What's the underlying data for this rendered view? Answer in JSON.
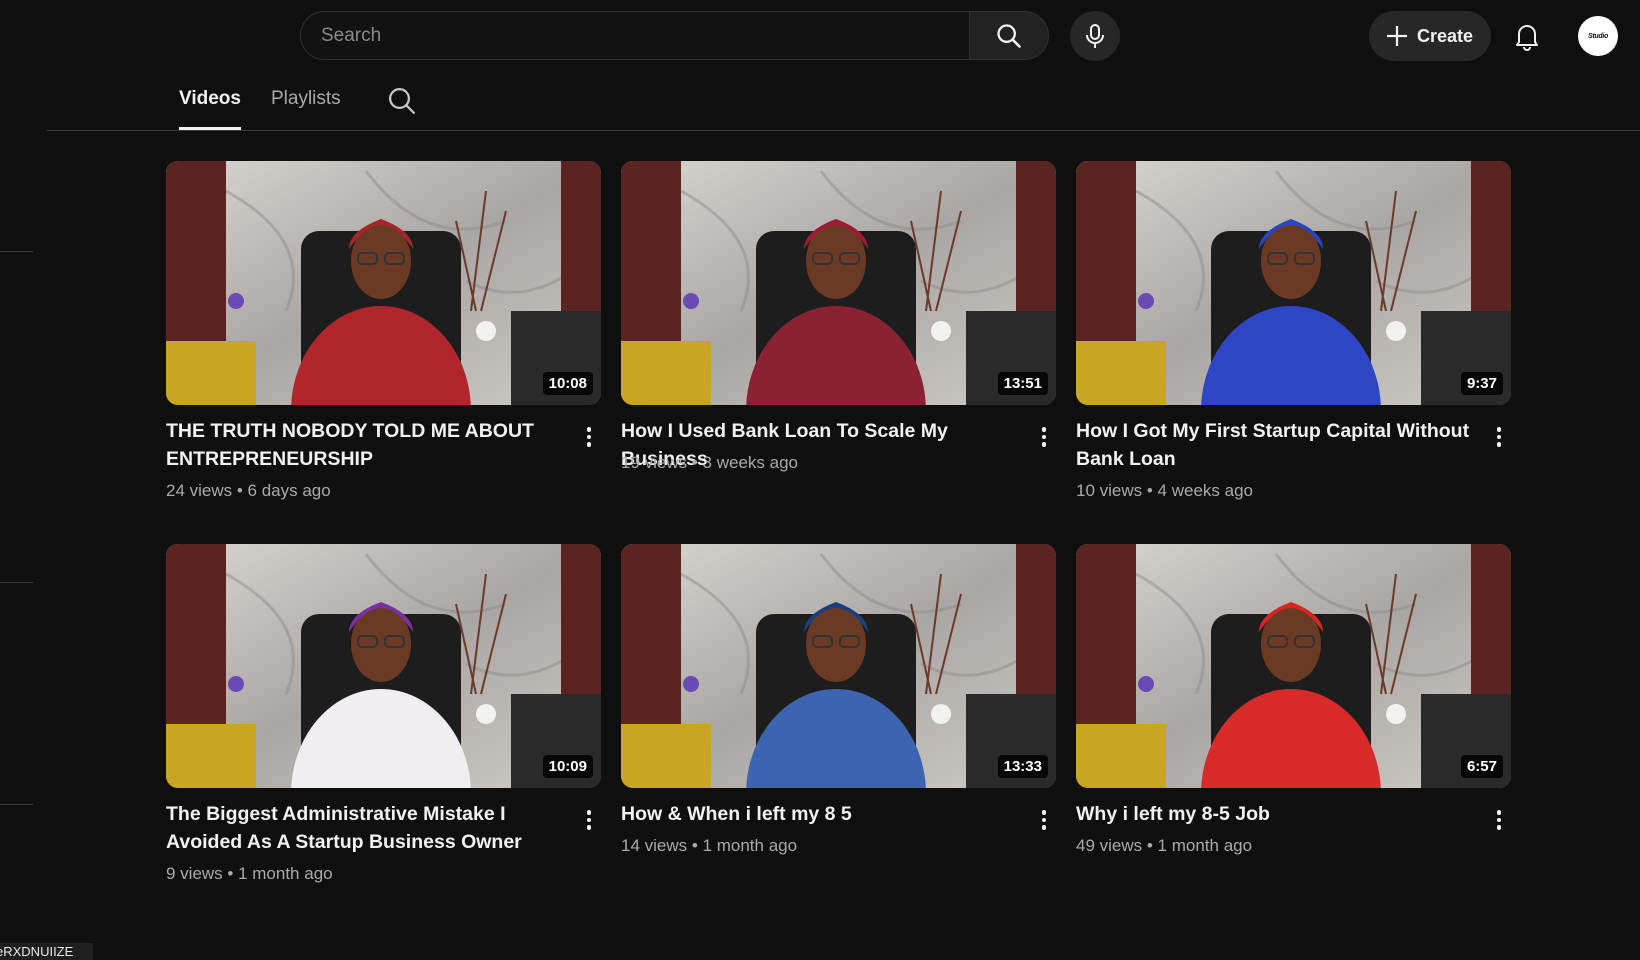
{
  "search": {
    "placeholder": "Search"
  },
  "header": {
    "create_label": "Create",
    "avatar_text": "Studio"
  },
  "tabs": [
    {
      "label": "Videos",
      "active": true
    },
    {
      "label": "Playlists",
      "active": false
    }
  ],
  "videos": [
    {
      "title_lines": [
        "THE TRUTH NOBODY TOLD ME ABOUT",
        "ENTREPRENEURSHIP"
      ],
      "meta": "24 views • 6 days ago",
      "duration": "10:08",
      "outfit_color": "#b0262c",
      "headwrap_color": "#a8262b"
    },
    {
      "title_lines": [
        "How I Used Bank Loan To Scale My Business"
      ],
      "meta": "19 views • 3 weeks ago",
      "duration": "13:51",
      "outfit_color": "#8a2233",
      "headwrap_color": "#a01a37"
    },
    {
      "title_lines": [
        "How I Got My First Startup Capital Without",
        "Bank Loan"
      ],
      "meta": "10 views • 4 weeks ago",
      "duration": "9:37",
      "outfit_color": "#2e45c6",
      "headwrap_color": "#2a46bf"
    },
    {
      "title_lines": [
        "The Biggest Administrative Mistake I",
        "Avoided As A Startup Business Owner"
      ],
      "meta": "9 views • 1 month ago",
      "duration": "10:09",
      "outfit_color": "#f0eef0",
      "headwrap_color": "#7b2fa0"
    },
    {
      "title_lines": [
        "How & When i left my 8 5"
      ],
      "meta": "14 views • 1 month ago",
      "duration": "13:33",
      "outfit_color": "#3d64b0",
      "headwrap_color": "#1b3f7a"
    },
    {
      "title_lines": [
        "Why i left my 8-5 Job"
      ],
      "meta": "49 views • 1 month ago",
      "duration": "6:57",
      "outfit_color": "#d92a2a",
      "headwrap_color": "#d92424"
    }
  ],
  "corner_text": "eRXDNUIIZE"
}
